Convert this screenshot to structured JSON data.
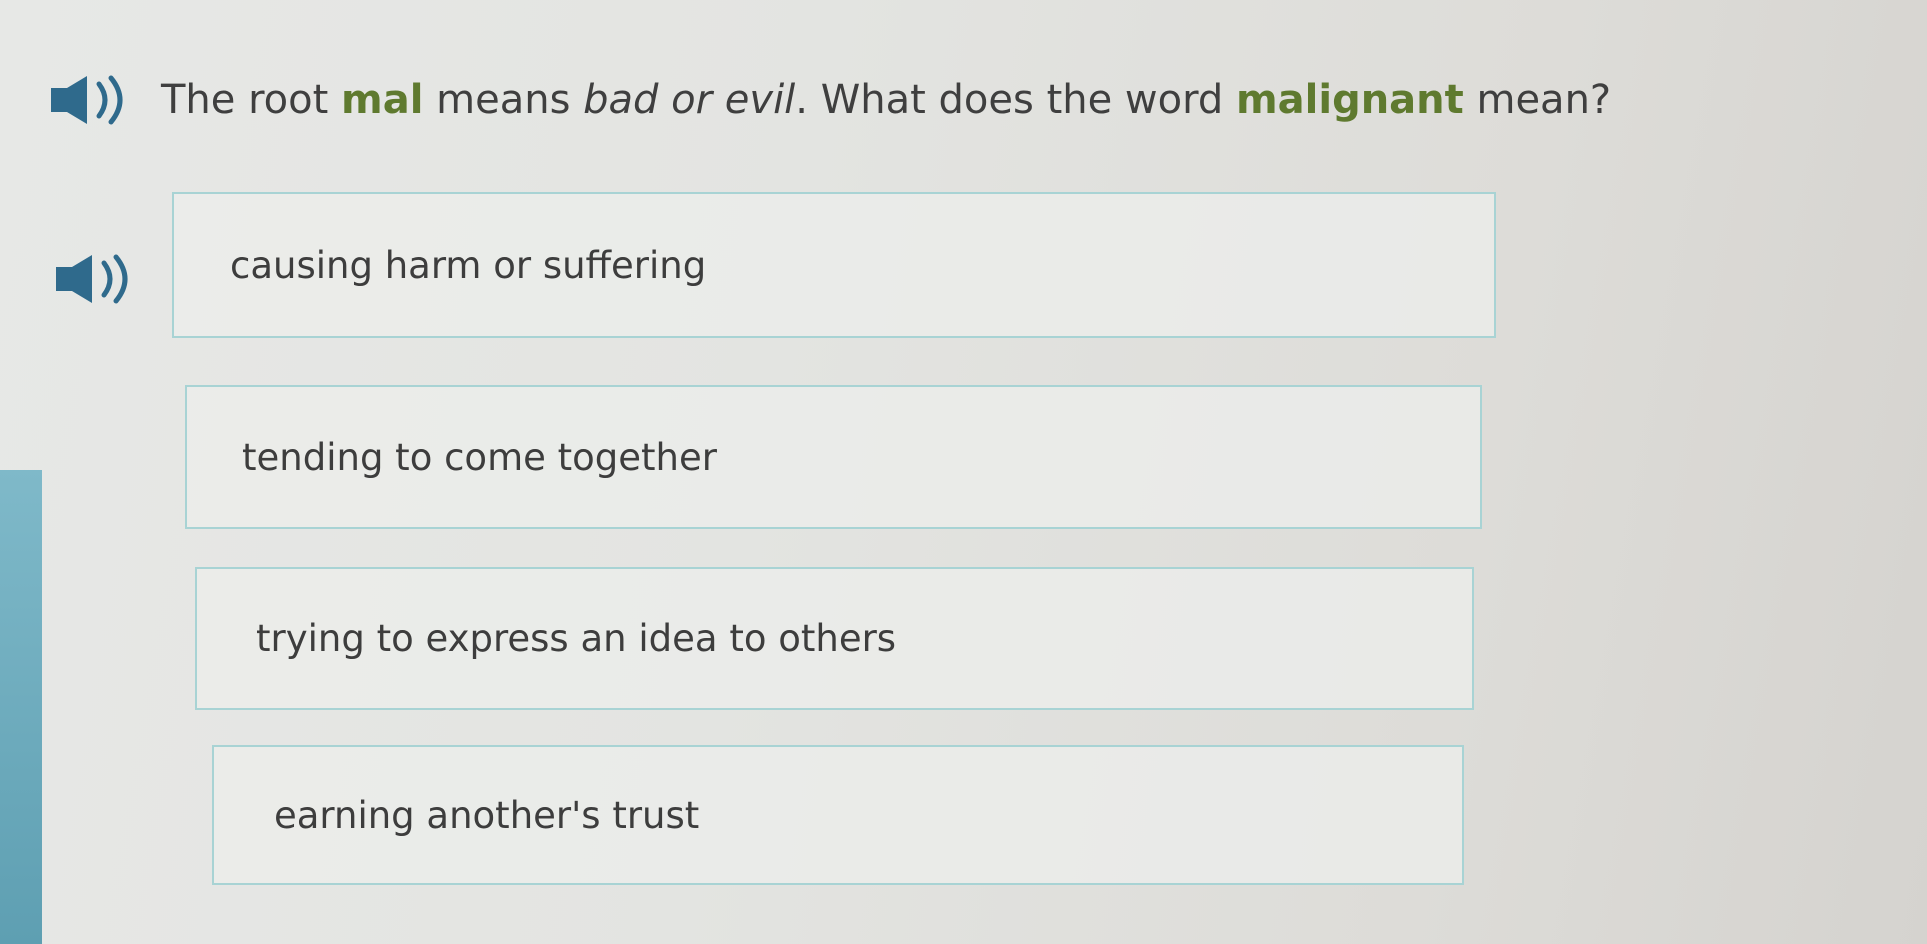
{
  "question": {
    "prefix": "The root ",
    "root": "mal",
    "middle": " means ",
    "meaning": "bad or evil",
    "middle2": ". What does the word ",
    "word": "malignant",
    "suffix": " mean?",
    "audio_icon": "speaker-icon"
  },
  "choices": [
    {
      "label": "causing harm or suffering",
      "audio_icon": "speaker-icon"
    },
    {
      "label": "tending to come together"
    },
    {
      "label": "trying to express an idea to others"
    },
    {
      "label": "earning another's trust"
    }
  ],
  "colors": {
    "keyword": "#5f7a2f",
    "choice_border": "#a8d3d4",
    "side_strip": "#6aa9bb",
    "speaker": "#2f6a8c"
  }
}
